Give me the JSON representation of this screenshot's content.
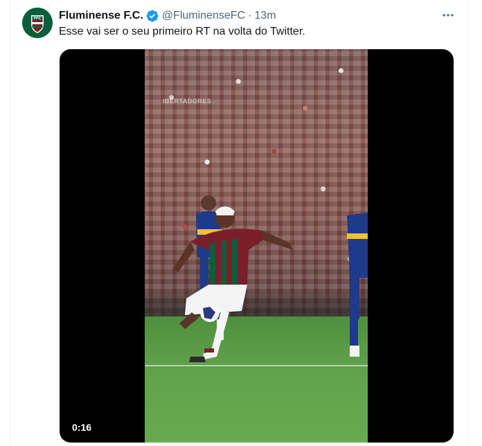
{
  "tweet": {
    "display_name": "Fluminense F.C.",
    "handle": "@FluminenseFC",
    "separator": "·",
    "time": "13m",
    "text": "Esse vai ser o seu primeiro RT na volta do Twitter."
  },
  "media": {
    "type": "video",
    "duration": "0:16",
    "watermark": "IBERTADORES"
  },
  "icons": {
    "verified": "verified-badge-icon",
    "more": "more-options-icon",
    "avatar": "fluminense-crest"
  },
  "colors": {
    "verified_blue": "#1d9bf0",
    "text_primary": "#0f1419",
    "text_secondary": "#536471",
    "crest_green": "#0b5e3a",
    "crest_maroon": "#7b1e2b"
  }
}
